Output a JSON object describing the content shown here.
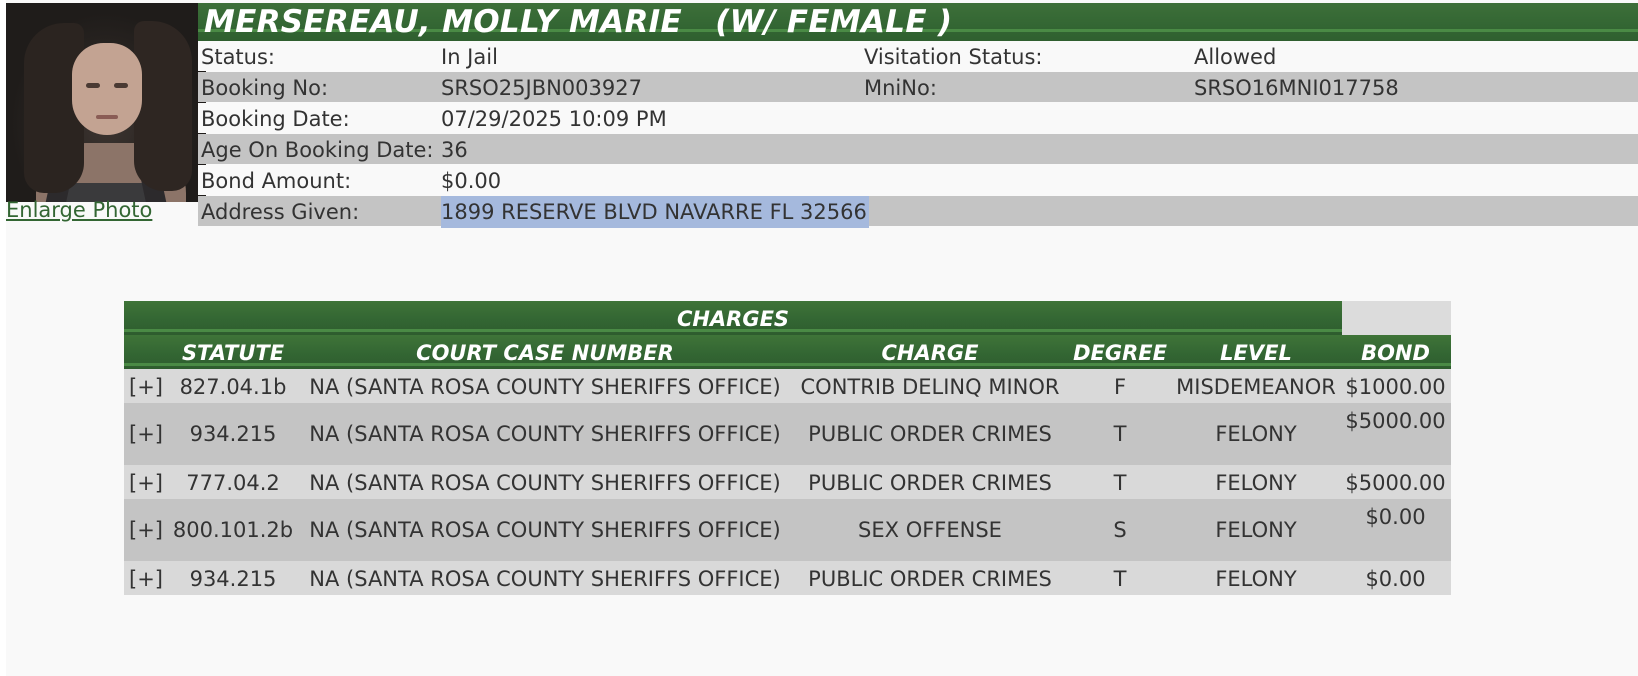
{
  "inmate": {
    "name_header": "MERSEREAU, MOLLY MARIE   (W/ FEMALE )",
    "photo_link": "Enlarge Photo"
  },
  "details": {
    "status_label": "Status:",
    "status_value": "In Jail",
    "visitation_label": "Visitation Status:",
    "visitation_value": "Allowed",
    "booking_no_label": "Booking No:",
    "booking_no_value": "SRSO25JBN003927",
    "mni_label": "MniNo:",
    "mni_value": "SRSO16MNI017758",
    "booking_date_label": "Booking Date:",
    "booking_date_value": "07/29/2025 10:09 PM",
    "age_label": "Age On Booking Date:",
    "age_value": "36",
    "bond_label": "Bond Amount:",
    "bond_value": "$0.00",
    "address_label": "Address Given:",
    "address_value": "1899 RESERVE BLVD NAVARRE FL 32566"
  },
  "charges": {
    "title": "CHARGES",
    "headers": {
      "statute": "STATUTE",
      "case": "COURT CASE NUMBER",
      "charge": "CHARGE",
      "degree": "DEGREE",
      "level": "LEVEL",
      "bond": "BOND"
    },
    "rows": [
      {
        "expand": "[+]",
        "statute": "827.04.1b",
        "case": "NA (SANTA ROSA COUNTY SHERIFFS OFFICE)",
        "charge": "CONTRIB DELINQ MINOR",
        "degree": "F",
        "level": "MISDEMEANOR",
        "bond": "$1000.00"
      },
      {
        "expand": "[+]",
        "statute": "934.215",
        "case": "NA (SANTA ROSA COUNTY SHERIFFS OFFICE)",
        "charge": "PUBLIC ORDER CRIMES",
        "degree": "T",
        "level": "FELONY",
        "bond": "$5000.00"
      },
      {
        "expand": "[+]",
        "statute": "777.04.2",
        "case": "NA (SANTA ROSA COUNTY SHERIFFS OFFICE)",
        "charge": "PUBLIC ORDER CRIMES",
        "degree": "T",
        "level": "FELONY",
        "bond": "$5000.00"
      },
      {
        "expand": "[+]",
        "statute": "800.101.2b",
        "case": "NA (SANTA ROSA COUNTY SHERIFFS OFFICE)",
        "charge": "SEX OFFENSE",
        "degree": "S",
        "level": "FELONY",
        "bond": "$0.00"
      },
      {
        "expand": "[+]",
        "statute": "934.215",
        "case": "NA (SANTA ROSA COUNTY SHERIFFS OFFICE)",
        "charge": "PUBLIC ORDER CRIMES",
        "degree": "T",
        "level": "FELONY",
        "bond": "$0.00"
      }
    ]
  },
  "colors": {
    "header_green": "#336633",
    "row_grey": "#c4c4c4",
    "row_light": "#d9d9d9",
    "selection_highlight": "#a5b9dd"
  }
}
